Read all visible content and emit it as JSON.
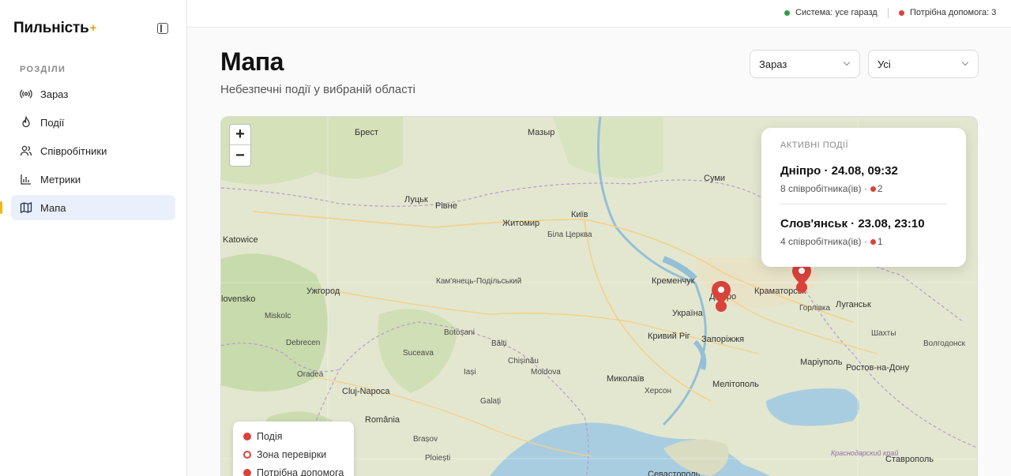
{
  "app": {
    "brand": "Пильність",
    "brand_plus": "+"
  },
  "sidebar": {
    "section_label": "РОЗДІЛИ",
    "items": [
      {
        "label": "Зараз",
        "icon": "broadcast-icon"
      },
      {
        "label": "Події",
        "icon": "flame-icon"
      },
      {
        "label": "Співробітники",
        "icon": "users-icon"
      },
      {
        "label": "Метрики",
        "icon": "bar-chart-icon"
      },
      {
        "label": "Мапа",
        "icon": "map-icon",
        "active": true
      }
    ]
  },
  "topbar": {
    "status_ok": "Система: усе гаразд",
    "status_ok_color": "#2f9e44",
    "status_help": "Потрібна допомога: 3",
    "status_help_color": "#d9423a"
  },
  "page": {
    "title": "Мапа",
    "subtitle": "Небезпечні події у вибраній області"
  },
  "filters": {
    "time_selected": "Зараз",
    "scope_selected": "Усі"
  },
  "map": {
    "zoom_in": "+",
    "zoom_out": "−",
    "labels": {
      "brest": "Брест",
      "mazyr": "Мазыр",
      "sumy": "Суми",
      "lutsk": "Луцьк",
      "rivne": "Рівне",
      "zhytomyr": "Житомир",
      "kyiv": "Київ",
      "bila_tserkva": "Біла Церква",
      "katowice": "Katowice",
      "kamianets": "Кам'янець-Подільський",
      "kremenchuk": "Кременчук",
      "kramatorsk": "Краматорськ",
      "luhansk": "Луганськ",
      "uzhhorod": "Ужгород",
      "ukraine": "Україна",
      "horlivka": "Горлівка",
      "slovensko": "lovensko",
      "miskolc": "Miskolc",
      "kryvyi_rih": "Кривий Ріг",
      "zaporizhzhia": "Запоріжжя",
      "debrecen": "Debrecen",
      "botosani": "Botoșani",
      "balti": "Bălți",
      "shakhty": "Шахты",
      "volgodonsk": "Волгодонск",
      "mariupol": "Маріуполь",
      "rostov": "Ростов-на-Дону",
      "suceava": "Suceava",
      "iasi": "Iași",
      "chisinau": "Chișinău",
      "moldova": "Moldova",
      "mykolaiv": "Миколаїв",
      "kherson": "Херсон",
      "melitopol": "Мелітополь",
      "oradea": "Oradea",
      "cluj": "Cluj-Napoca",
      "galati": "Galați",
      "romania": "România",
      "brasov": "Brașov",
      "ploiesti": "Ploiești",
      "stavropol": "Ставрополь",
      "sevastopol": "Севастополь",
      "krasnodar": "Краснодарский край",
      "dnipro": "Дніпро"
    }
  },
  "active_events": {
    "header": "АКТИВНІ ПОДІЇ",
    "items": [
      {
        "title": "Дніпро · 24.08, 09:32",
        "meta": "8 співробітника(ів) ·",
        "help_count": "2"
      },
      {
        "title": "Слов'янськ · 23.08, 23:10",
        "meta": "4 співробітника(ів) ·",
        "help_count": "1"
      }
    ]
  },
  "legend": {
    "event": "Подія",
    "event_color": "#d9423a",
    "check_zone": "Зона перевірки",
    "help_needed": "Потрібна допомога"
  }
}
